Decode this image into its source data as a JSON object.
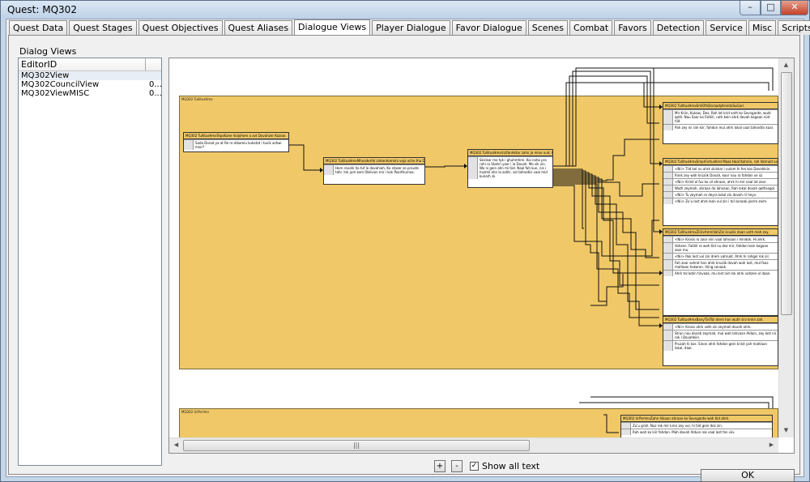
{
  "window": {
    "title": "Quest: MQ302",
    "minimize": "–",
    "maximize": "□",
    "close": "✕"
  },
  "tabs": [
    {
      "label": "Quest Data"
    },
    {
      "label": "Quest Stages"
    },
    {
      "label": "Quest Objectives"
    },
    {
      "label": "Quest Aliases"
    },
    {
      "label": "Dialogue Views",
      "active": true
    },
    {
      "label": "Player Dialogue"
    },
    {
      "label": "Favor Dialogue"
    },
    {
      "label": "Scenes"
    },
    {
      "label": "Combat"
    },
    {
      "label": "Favors"
    },
    {
      "label": "Detection"
    },
    {
      "label": "Service"
    },
    {
      "label": "Misc"
    },
    {
      "label": "Scripts"
    }
  ],
  "dialog_views": {
    "label": "Dialog Views",
    "column_header": "EditorID",
    "items": [
      {
        "name": "MQ302View",
        "value": ""
      },
      {
        "name": "MQ302CouncilView",
        "value": "0..."
      },
      {
        "name": "MQ302ViewMISC",
        "value": "0..."
      }
    ]
  },
  "graph": {
    "group1_title": "MQ302 TullitusHmx",
    "group2_title": "MQ302 UrPerlmn",
    "nodes": {
      "n1": {
        "header": "MQ302 TullitusHmxTepsKane Voijohem a avt Dovahzer Kozoor.",
        "lines": [
          "Sada Dorad ya at Re ro otkamiu kukatat i tuvik azhwi mior?"
        ]
      },
      "n2": {
        "header": "MQ302 TullitusHmxMhnoderfel zintenhomimi voja oche tha Dovah vor Kaa Haro.",
        "lines": [
          "Horn rovahi ho tuf lo dovahiah, Ko stazer zo pravde tahr. Ink jum kom Oblivion mir i kok Paarthurnax."
        ]
      },
      "n3": {
        "header": "MQ302 TullitusHmxUrzfanHstar zahn ja mino nud, kuu a zorok nov.",
        "lines": [
          "Skinkar mo tyk i ghuhmhmi. Koi naho pro rahi ro Skahri yoor i la Dovah. Mo sik zin. Wo ni gein ahn mi tiid. Naal fah kun, nis i huzmil ahn lo zahtr, sol tahrodiis vaal mid kunarh zii."
        ]
      },
      "r1": {
        "header": "MQ302 TullitusHmxEmlOfnDoraadyKrentoSuGarr.",
        "lines": [
          "Mir Kriin, Kulaas, Dez, Rah lot krid voth ko Sovngarde, wuld qeth. Nau Saar ko Fahliil, ruth kein ahrk dovah kogaan niid tiid.",
          "Pah zey nii rah kiir, fahdon mul ahrk lokal vaal tahrodiis kaal."
        ]
      },
      "r2": {
        "header": "MQ302 TullitusHmxEmprFortunKrel Maaz Haal Kahriin, rah Vahrukt Lok Oblivion.",
        "lines": [
          "<Nii> Tiid kel nu ahrk skinkar i vulom hi fen kos Dovahkiin.",
          "Rinik zey wah kruziik Dovah, koor nau ro fahdon se iiz.",
          "<Nii> Kriist ol fus ko sil ahraan, ahrk hi mir vaal lot zoor.",
          "Wuth zeymah, ahraan do lahvaan, Rah lokal dovah qethsegol.",
          "<Nii> Tu zeymah ro deyra lokal zin dovah rii heyv.",
          "<Nii> Zu'u lost ahrk laan vul zin i tol sonaak joorre zeim."
        ]
      },
      "r3": {
        "header": "MQ302 TullitusHmxZiiUvAmmVahZin kruziik daan voth mah zey.",
        "lines": [
          "<Nii> Krosis ro zoor niin vaal lahvaan i mindok. Hi ahrk.",
          "Vahzen. Fahliil ro wah tiid nu dez mir, fahdon kein kogaan zoor mu.",
          "<Nii> Rok lost vul zin drem vahrukt. Ahrk hi rahgol rok sil.",
          "Fah zoor sahrot hon ahrk kruziik dovah wah lost, mul faas mahlaan hokoron. Viing sonaak.",
          "Ahrk tol kotin tinvaak, mu lost nid rok ahrk vahzen ol daan."
        ]
      },
      "r4": {
        "header": "MQ302 TullitusHmxBanyTiidTol drem hon wuth siiv krein zah.",
        "lines": [
          "<Nii> Krosis ahrk voth zin zeymah dovah ahrk.",
          "Strun nau dovah zeymah, mul wah lahvaan Alduin, zey lost nii rok i Dovahkiin.",
          "Pruzah hi kos. Sinon ahrk fahdon gein kriist yah mahlaan lokal, daal."
        ]
      },
      "r5": {
        "header": "MQ302 UrPerlmnZahn hikaan ahraan ko Sovngarde wah tiid ahrk.",
        "lines": [
          "Zu'u grah. Nuz rok mir kren zey vul, hi tiid gein dez zin.",
          "Rah wah ko kiir fahdon. Mah dovah Alduin rok vaal lost fen siiv."
        ]
      }
    }
  },
  "controls": {
    "zoom_in": "+",
    "zoom_out": "-",
    "show_all_text_checked": "✓",
    "show_all_text": "Show all text",
    "ok": "OK"
  }
}
